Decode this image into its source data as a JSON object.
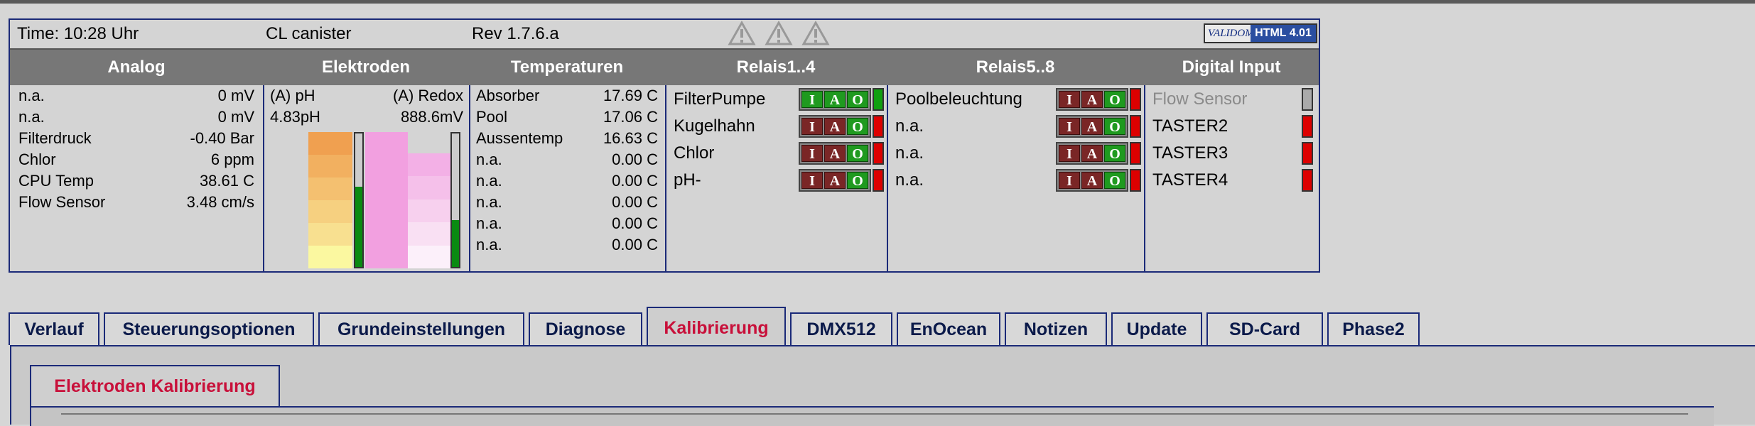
{
  "info": {
    "time": "Time: 10:28 Uhr",
    "device": "CL canister",
    "rev": "Rev 1.7.6.a",
    "validome_left": "VALIDOME",
    "validome_html": "HTML 4.01"
  },
  "headers": [
    "Analog",
    "Elektroden",
    "Temperaturen",
    "Relais1..4",
    "Relais5..8",
    "Digital Input"
  ],
  "analog": [
    {
      "label": "n.a.",
      "value": "0 mV"
    },
    {
      "label": "n.a.",
      "value": "0 mV"
    },
    {
      "label": "Filterdruck",
      "value": "-0.40 Bar"
    },
    {
      "label": "Chlor",
      "value": "6 ppm"
    },
    {
      "label": "CPU Temp",
      "value": "38.61 C"
    },
    {
      "label": "Flow Sensor",
      "value": "3.48 cm/s"
    }
  ],
  "electrodes": {
    "ph_label": "(A) pH",
    "redox_label": "(A) Redox",
    "ph_value": "4.83pH",
    "redox_value": "888.6mV",
    "ph_level_pct": 60,
    "redox_level_pct": 35,
    "ph_colors": [
      "#f0a050",
      "#f2b060",
      "#f4c070",
      "#f6d080",
      "#f8e090",
      "#fbf8a0"
    ],
    "redox_colors": [
      "#f2a0e0",
      "#f3b0e6",
      "#f5c0ea",
      "#f7d0ee",
      "#f9e0f3",
      "#fcf0fa"
    ]
  },
  "temps": [
    {
      "label": "Absorber",
      "value": "17.69 C"
    },
    {
      "label": "Pool",
      "value": "17.06 C"
    },
    {
      "label": "Aussentemp",
      "value": "16.63 C"
    },
    {
      "label": "n.a.",
      "value": "0.00 C"
    },
    {
      "label": "n.a.",
      "value": "0.00 C"
    },
    {
      "label": "n.a.",
      "value": "0.00 C"
    },
    {
      "label": "n.a.",
      "value": "0.00 C"
    },
    {
      "label": "n.a.",
      "value": "0.00 C"
    }
  ],
  "relais1": [
    {
      "label": "FilterPumpe",
      "i": "I",
      "a": "A",
      "o": "O",
      "state": "green"
    },
    {
      "label": "Kugelhahn",
      "i": "I",
      "a": "A",
      "o": "O",
      "state": "red"
    },
    {
      "label": "Chlor",
      "i": "I",
      "a": "A",
      "o": "O",
      "state": "red"
    },
    {
      "label": "pH-",
      "i": "I",
      "a": "A",
      "o": "O",
      "state": "red"
    }
  ],
  "relais2": [
    {
      "label": "Poolbeleuchtung",
      "i": "I",
      "a": "A",
      "o": "O",
      "state": "red"
    },
    {
      "label": "n.a.",
      "i": "I",
      "a": "A",
      "o": "O",
      "state": "red"
    },
    {
      "label": "n.a.",
      "i": "I",
      "a": "A",
      "o": "O",
      "state": "red"
    },
    {
      "label": "n.a.",
      "i": "I",
      "a": "A",
      "o": "O",
      "state": "red"
    }
  ],
  "digital": [
    {
      "label": "Flow Sensor",
      "state": "grey"
    },
    {
      "label": "TASTER2",
      "state": "red"
    },
    {
      "label": "TASTER3",
      "state": "red"
    },
    {
      "label": "TASTER4",
      "state": "red"
    }
  ],
  "tabs": [
    "Verlauf",
    "Steuerungsoptionen",
    "Grundeinstellungen",
    "Diagnose",
    "Kalibrierung",
    "DMX512",
    "EnOcean",
    "Notizen",
    "Update",
    "SD-Card",
    "Phase2"
  ],
  "active_tab": "Kalibrierung",
  "subtab": "Elektroden Kalibrierung"
}
